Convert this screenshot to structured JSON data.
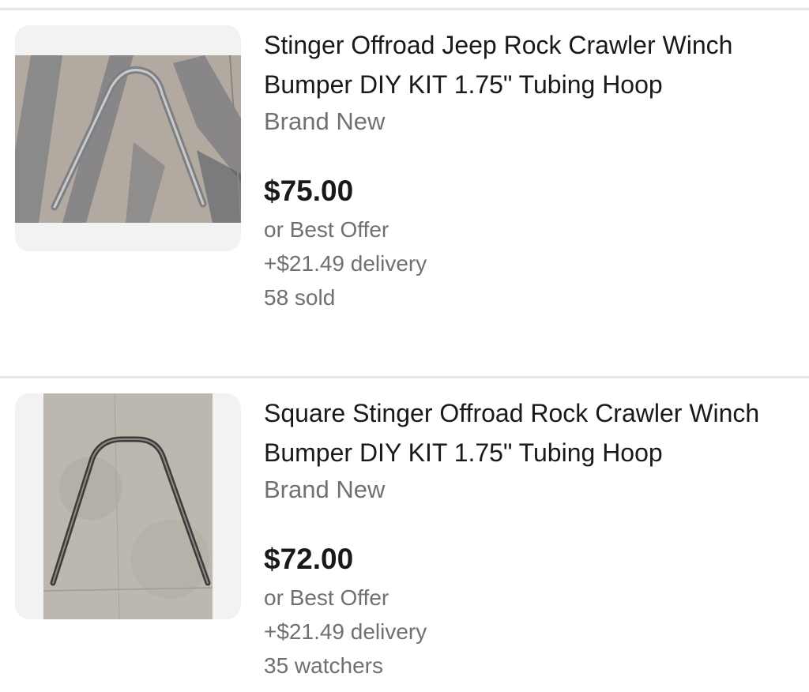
{
  "listings": [
    {
      "image_alt": "bent steel tubing hoop on concrete",
      "title": "Stinger Offroad Jeep Rock Crawler Winch Bumper DIY KIT 1.75\" Tubing Hoop",
      "condition": "Brand New",
      "price": "$75.00",
      "offer": "or Best Offer",
      "delivery": "+$21.49 delivery",
      "extra": "58 sold"
    },
    {
      "image_alt": "square bent steel tubing hoop on concrete",
      "title": "Square Stinger Offroad Rock Crawler Winch Bumper DIY KIT 1.75\" Tubing Hoop",
      "condition": "Brand New",
      "price": "$72.00",
      "offer": "or Best Offer",
      "delivery": "+$21.49 delivery",
      "extra": "35 watchers"
    }
  ]
}
